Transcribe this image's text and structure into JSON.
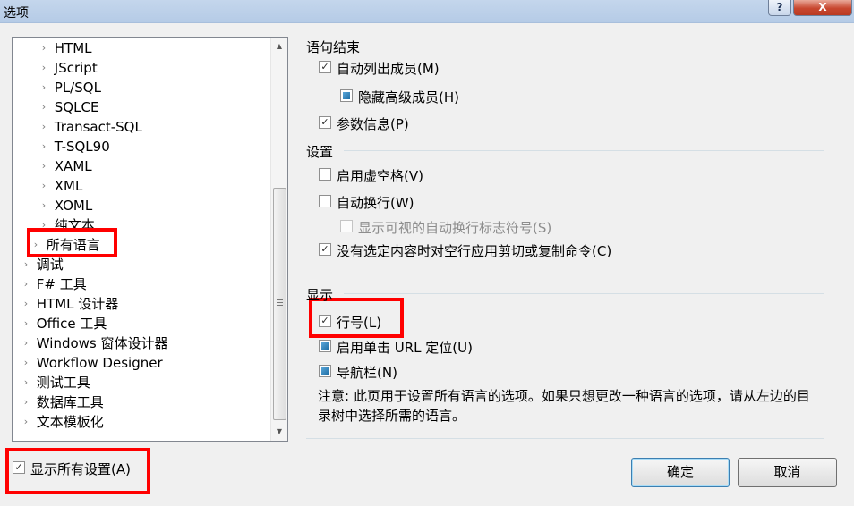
{
  "window": {
    "title": "选项",
    "help_label": "?",
    "close_label": "X"
  },
  "tree": {
    "items": [
      {
        "label": "HTML"
      },
      {
        "label": "JScript"
      },
      {
        "label": "PL/SQL"
      },
      {
        "label": "SQLCE"
      },
      {
        "label": "Transact-SQL"
      },
      {
        "label": "T-SQL90"
      },
      {
        "label": "XAML"
      },
      {
        "label": "XML"
      },
      {
        "label": "XOML"
      },
      {
        "label": "纯文本"
      },
      {
        "label": "所有语言"
      },
      {
        "label": "调试"
      },
      {
        "label": "F# 工具"
      },
      {
        "label": "HTML 设计器"
      },
      {
        "label": "Office 工具"
      },
      {
        "label": "Windows 窗体设计器"
      },
      {
        "label": "Workflow Designer"
      },
      {
        "label": "测试工具"
      },
      {
        "label": "数据库工具"
      },
      {
        "label": "文本模板化"
      }
    ]
  },
  "show_all_settings": {
    "label": "显示所有设置(A)",
    "checked": true
  },
  "groups": {
    "statement_completion": {
      "title": "语句结束",
      "auto_list_members": {
        "label": "自动列出成员(M)",
        "state": "checked"
      },
      "hide_advanced_members": {
        "label": "隐藏高级成员(H)",
        "state": "indeterminate"
      },
      "parameter_information": {
        "label": "参数信息(P)",
        "state": "checked"
      }
    },
    "settings": {
      "title": "设置",
      "enable_virtual_space": {
        "label": "启用虚空格(V)",
        "state": "unchecked"
      },
      "word_wrap": {
        "label": "自动换行(W)",
        "state": "unchecked"
      },
      "show_wrap_glyphs": {
        "label": "显示可视的自动换行标志符号(S)",
        "state": "disabled"
      },
      "apply_cut_copy": {
        "label": "没有选定内容时对空行应用剪切或复制命令(C)",
        "state": "checked"
      }
    },
    "display": {
      "title": "显示",
      "line_numbers": {
        "label": "行号(L)",
        "state": "checked"
      },
      "single_click_url": {
        "label": "启用单击 URL 定位(U)",
        "state": "indeterminate"
      },
      "navigation_bar": {
        "label": "导航栏(N)",
        "state": "indeterminate"
      }
    }
  },
  "note": "注意: 此页用于设置所有语言的选项。如果只想更改一种语言的选项，请从左边的目录树中选择所需的语言。",
  "buttons": {
    "ok": "确定",
    "cancel": "取消"
  },
  "colors": {
    "highlight": "#ff0000",
    "titlebar": "#c4d6ec",
    "close": "#c8472f"
  }
}
